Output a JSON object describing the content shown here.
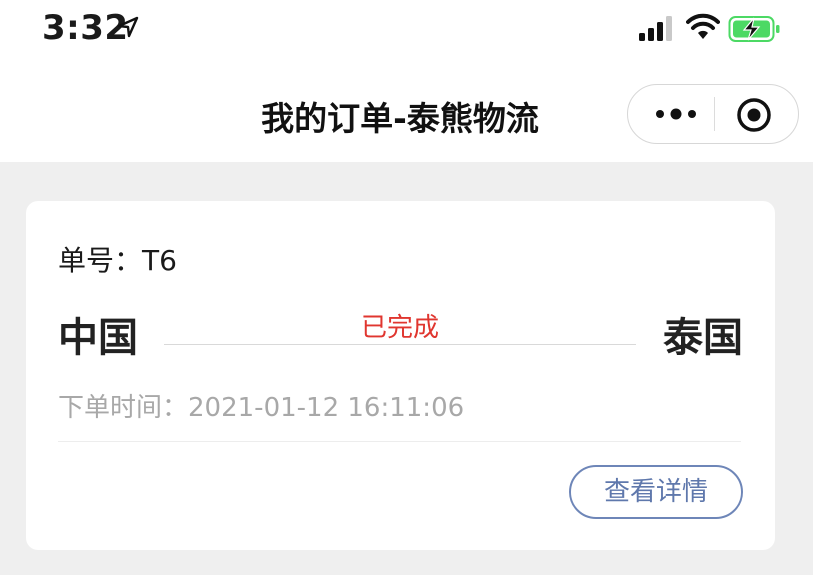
{
  "status_bar": {
    "time": "3:32",
    "icons": [
      "location-arrow-icon",
      "signal-icon",
      "wifi-icon",
      "battery-charging-icon"
    ]
  },
  "nav": {
    "title": "我的订单-泰熊物流",
    "menu_icon": "more-dots-icon",
    "close_icon": "target-icon"
  },
  "order": {
    "number_label": "单号：",
    "number": "T6",
    "from": "中国",
    "to": "泰国",
    "status": "已完成",
    "time_label": "下单时间：",
    "time": "2021-01-12 16:11:06",
    "detail_button": "查看详情"
  },
  "colors": {
    "background": "#efefef",
    "status": "#e0362f",
    "button_border": "#6e86b8",
    "button_text": "#5f78ac",
    "battery": "#4cd964"
  }
}
